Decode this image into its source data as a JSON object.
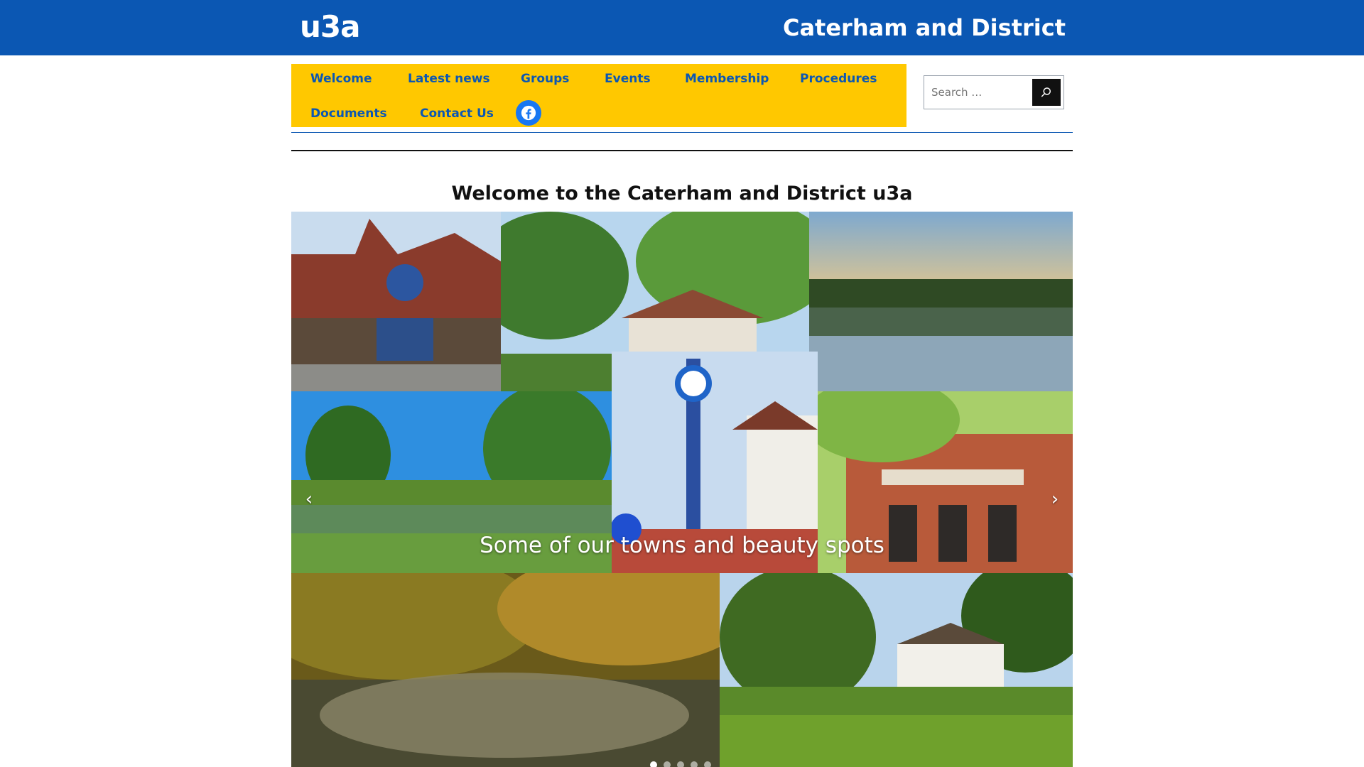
{
  "header": {
    "logo_text": "u3a",
    "site_title": "Caterham and District",
    "background_color": "#0b57b3"
  },
  "nav": {
    "background_color": "#ffc800",
    "link_color": "#0b57b3",
    "items": [
      {
        "label": "Welcome"
      },
      {
        "label": "Latest news"
      },
      {
        "label": "Groups"
      },
      {
        "label": "Events"
      },
      {
        "label": "Membership"
      },
      {
        "label": "Procedures"
      },
      {
        "label": "Documents"
      },
      {
        "label": "Contact Us"
      }
    ],
    "social_icon": "facebook-icon"
  },
  "search": {
    "placeholder": "Search …",
    "button_icon": "search-icon"
  },
  "main": {
    "heading": "Welcome to the Caterham and District u3a"
  },
  "slider": {
    "caption": "Some of our towns and beauty spots",
    "prev_icon": "chevron-left-icon",
    "next_icon": "chevron-right-icon",
    "slide_count": 5,
    "active_slide": 1
  }
}
